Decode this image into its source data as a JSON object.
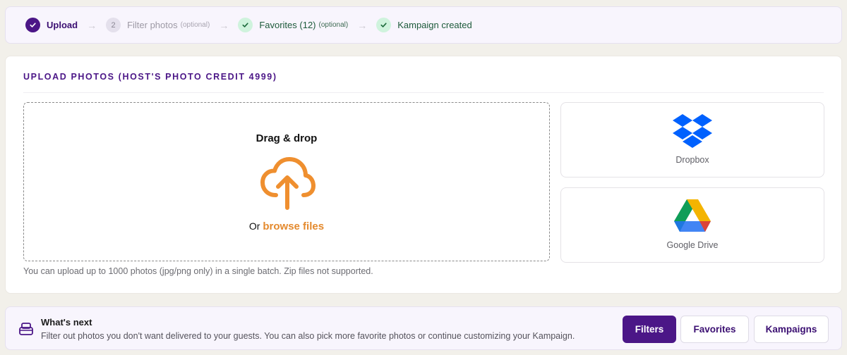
{
  "stepper": {
    "steps": [
      {
        "label": "Upload",
        "state": "active",
        "badge": "",
        "optional": ""
      },
      {
        "label": "Filter photos",
        "state": "pending",
        "badge": "2",
        "optional": "(optional)"
      },
      {
        "label": "Favorites (12)",
        "state": "done",
        "badge": "",
        "optional": "(optional)"
      },
      {
        "label": "Kampaign created",
        "state": "done",
        "badge": "",
        "optional": ""
      }
    ]
  },
  "upload": {
    "title": "UPLOAD PHOTOS (HOST'S PHOTO CREDIT 4999)",
    "dropzone_title": "Drag & drop",
    "or_text": "Or",
    "browse_label": "browse files",
    "hint": "You can upload up to 1000 photos (jpg/png only) in a single batch. Zip files not supported.",
    "sources": [
      {
        "label": "Dropbox",
        "icon": "dropbox-logo-icon"
      },
      {
        "label": "Google Drive",
        "icon": "google-drive-logo-icon"
      }
    ]
  },
  "next": {
    "title": "What's next",
    "description": "Filter out photos you don't want delivered to your guests. You can also pick more favorite photos or continue customizing your Kampaign.",
    "buttons": {
      "filters": "Filters",
      "favorites": "Favorites",
      "kampaigns": "Kampaigns"
    }
  },
  "colors": {
    "accent": "#4b1687",
    "browse": "#e48a2e",
    "done_bg": "#cff3dd",
    "dropbox": "#0061fe"
  }
}
